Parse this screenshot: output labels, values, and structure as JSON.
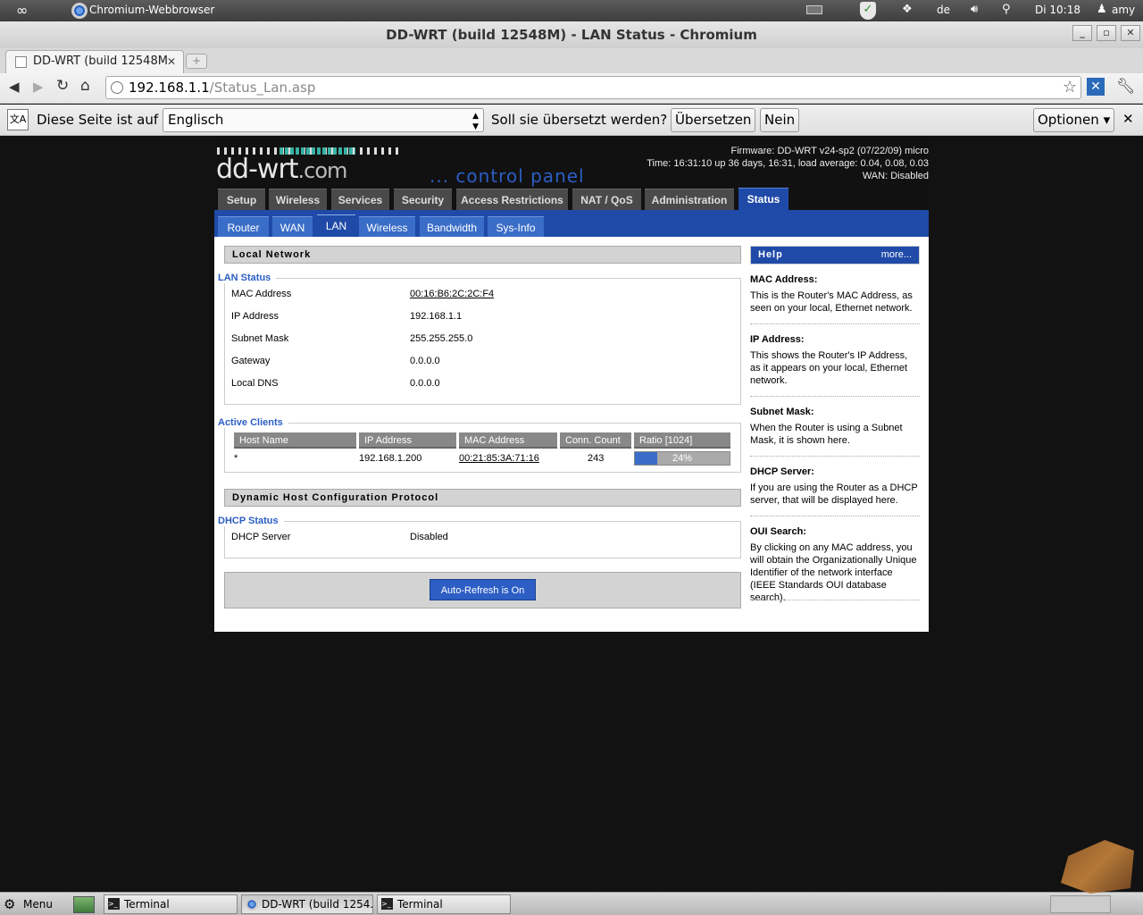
{
  "system_panel": {
    "app_name": "Chromium-Webbrowser",
    "keyboard": "de",
    "clock": "Di 10:18",
    "user": "amy"
  },
  "window": {
    "title": "DD-WRT (build 12548M) - LAN Status - Chromium"
  },
  "browser": {
    "tab_title": "DD-WRT (build 12548M",
    "url_host": "192.168.1.1",
    "url_path": "/Status_Lan.asp"
  },
  "translate_bar": {
    "prefix": "Diese Seite ist auf",
    "language": "Englisch",
    "question": "Soll sie übersetzt werden?",
    "translate_btn": "Übersetzen",
    "no_btn": "Nein",
    "options_btn": "Optionen ▾"
  },
  "router": {
    "logo_main": "dd-wrt",
    "logo_tld": ".com",
    "logo_tagline": "... control panel",
    "firmware": "Firmware: DD-WRT v24-sp2 (07/22/09) micro",
    "time": "Time: 16:31:10 up 36 days, 16:31, load average: 0.04, 0.08, 0.03",
    "wan": "WAN: Disabled",
    "main_tabs": [
      "Setup",
      "Wireless",
      "Services",
      "Security",
      "Access Restrictions",
      "NAT / QoS",
      "Administration",
      "Status"
    ],
    "sub_tabs": [
      "Router",
      "WAN",
      "LAN",
      "Wireless",
      "Bandwidth",
      "Sys-Info"
    ]
  },
  "local_network": {
    "section_title": "Local Network",
    "lan_status_legend": "LAN Status",
    "rows": [
      {
        "label": "MAC Address",
        "value": "00:16:B6:2C:2C:F4"
      },
      {
        "label": "IP Address",
        "value": "192.168.1.1"
      },
      {
        "label": "Subnet Mask",
        "value": "255.255.255.0"
      },
      {
        "label": "Gateway",
        "value": "0.0.0.0"
      },
      {
        "label": "Local DNS",
        "value": "0.0.0.0"
      }
    ],
    "active_clients_legend": "Active Clients",
    "clients_headers": [
      "Host Name",
      "IP Address",
      "MAC Address",
      "Conn. Count",
      "Ratio [1024]"
    ],
    "clients": [
      {
        "host": "*",
        "ip": "192.168.1.200",
        "mac": "00:21:85:3A:71:16",
        "count": "243",
        "ratio_label": "24%",
        "ratio": 0.24
      }
    ]
  },
  "dhcp": {
    "section_title": "Dynamic Host Configuration Protocol",
    "legend": "DHCP Status",
    "server_label": "DHCP Server",
    "server_value": "Disabled",
    "autorefresh": "Auto-Refresh is On"
  },
  "help": {
    "title": "Help",
    "more": "more...",
    "items": [
      {
        "title": "MAC Address:",
        "text": "This is the Router's MAC Address, as seen on your local, Ethernet network."
      },
      {
        "title": "IP Address:",
        "text": "This shows the Router's IP Address, as it appears on your local, Ethernet network."
      },
      {
        "title": "Subnet Mask:",
        "text": "When the Router is using a Subnet Mask, it is shown here."
      },
      {
        "title": "DHCP Server:",
        "text": "If you are using the Router as a DHCP server, that will be displayed here."
      },
      {
        "title": "OUI Search:",
        "text": "By clicking on any MAC address, you will obtain the Organizationally Unique Identifier of the network interface (IEEE Standards OUI database search)."
      }
    ]
  },
  "taskbar": {
    "menu": "Menu",
    "tasks": [
      "Terminal",
      "DD-WRT (build 1254...",
      "Terminal"
    ]
  },
  "colors": {
    "accent_blue": "#2c5ec4",
    "status_tab": "#1f4aa8",
    "progress_fill": "#3a6dc8"
  }
}
